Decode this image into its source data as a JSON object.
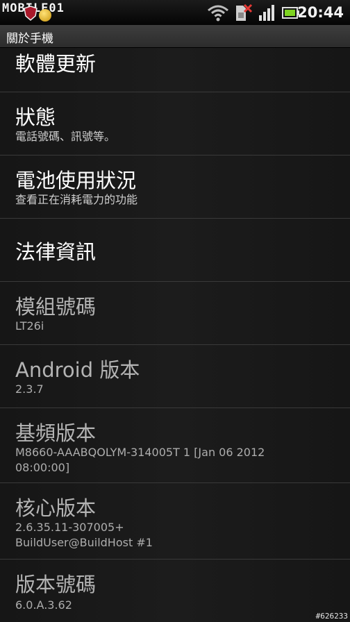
{
  "status_bar": {
    "watermark": "MOBILE01",
    "time": "20:44",
    "icons": [
      "shield-notification-icon",
      "notification-dot-icon",
      "wifi-icon",
      "sim-card-error-icon",
      "signal-bars-icon",
      "battery-icon"
    ]
  },
  "title_bar": {
    "title": "關於手機"
  },
  "items": [
    {
      "title": "軟體更新",
      "subtitle": ""
    },
    {
      "title": "狀態",
      "subtitle": "電話號碼、訊號等。"
    },
    {
      "title": "電池使用狀況",
      "subtitle": "查看正在消耗電力的功能"
    },
    {
      "title": "法律資訊",
      "subtitle": ""
    },
    {
      "title": "模組號碼",
      "subtitle": "LT26i"
    },
    {
      "title": "Android 版本",
      "subtitle": "2.3.7"
    },
    {
      "title": "基頻版本",
      "subtitle": "M8660-AAABQOLYM-314005T 1  [Jan 06 2012\n08:00:00]"
    },
    {
      "title": "核心版本",
      "subtitle": "2.6.35.11-307005+\nBuildUser@BuildHost #1"
    },
    {
      "title": "版本號碼",
      "subtitle": "6.0.A.3.62"
    }
  ],
  "image_id": "#626233",
  "colors": {
    "background": "#121212",
    "divider": "#3a3a3a",
    "wifi": "#bdbdbd",
    "battery": "#7ed321",
    "sim_error": "#e53935"
  }
}
